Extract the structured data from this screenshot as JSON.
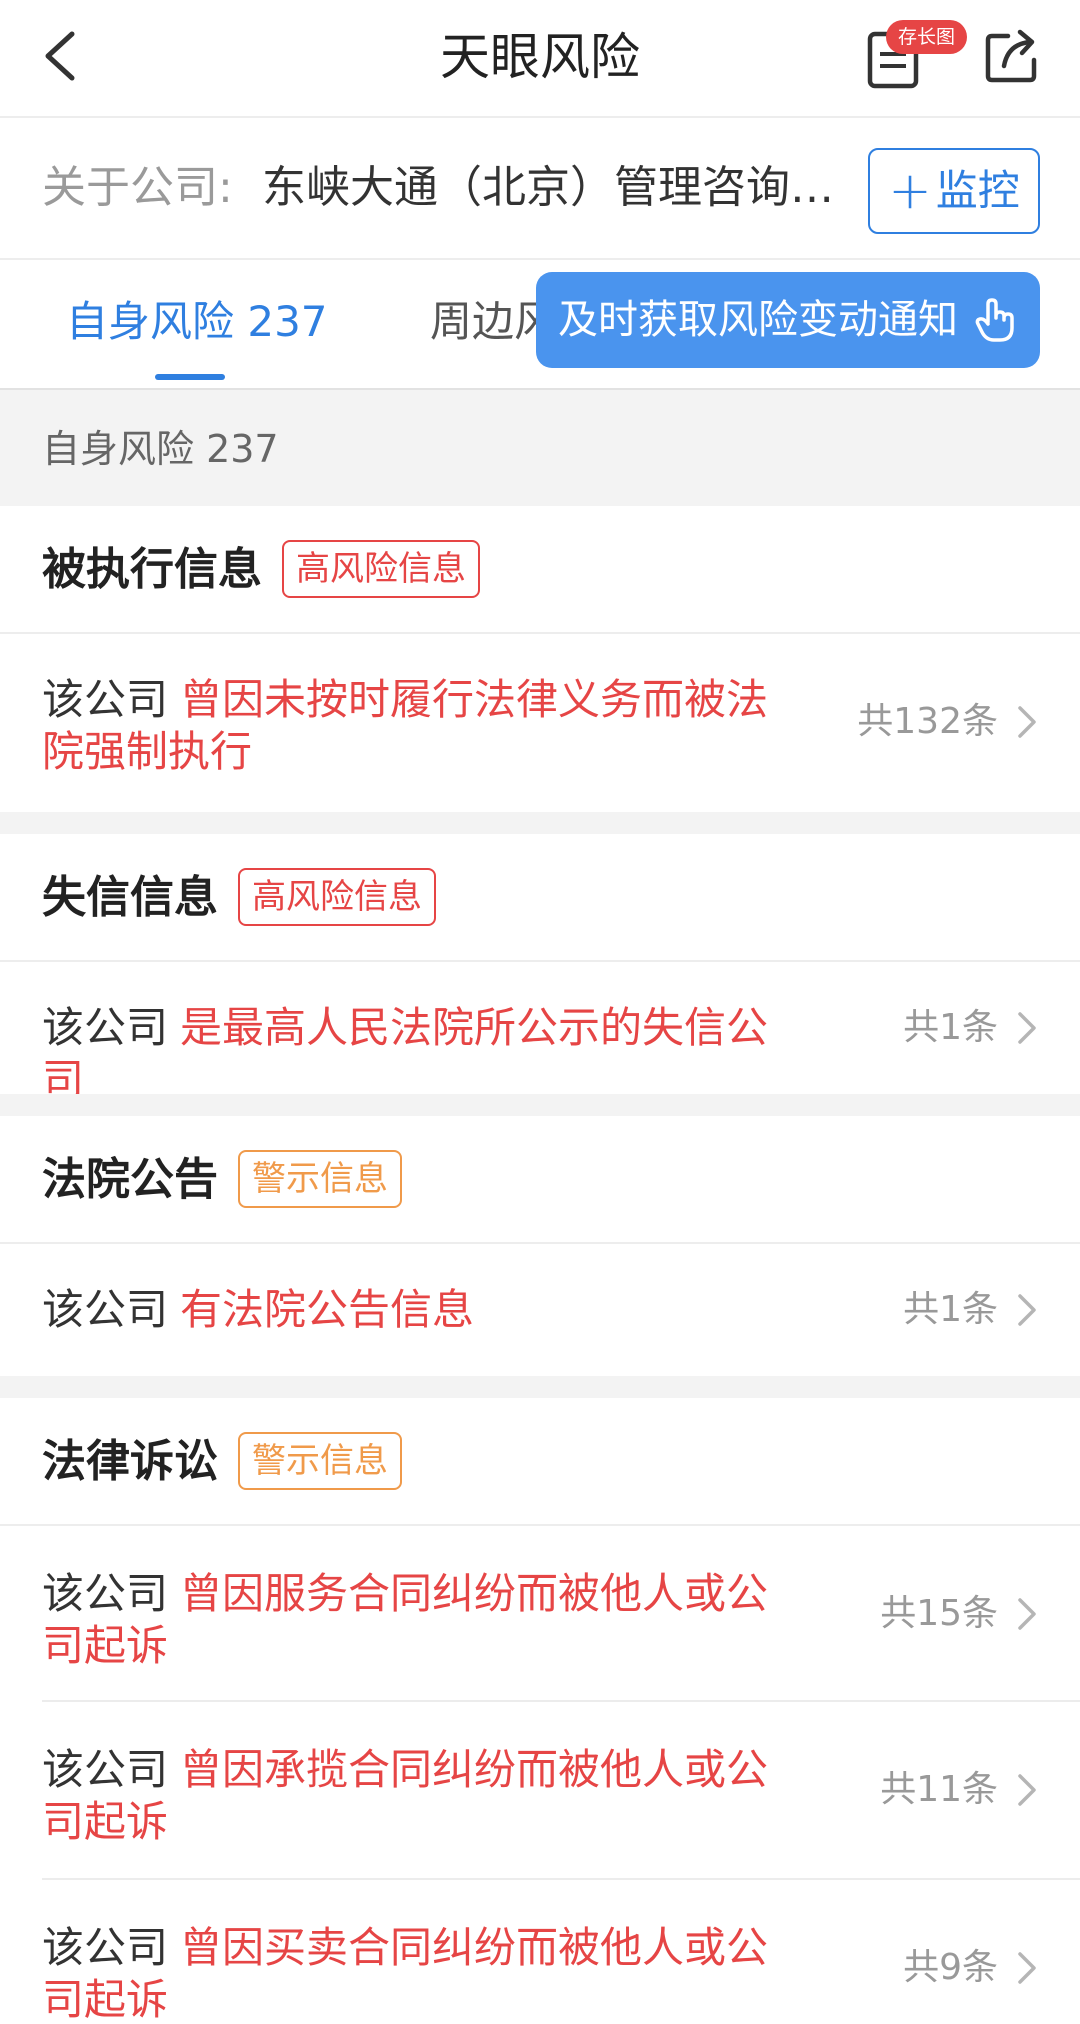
{
  "header": {
    "title": "天眼风险",
    "long_image_badge": "存长图"
  },
  "company": {
    "label": "关于公司:",
    "name": "东峡大通（北京）管理咨询…",
    "monitor_label": "监控"
  },
  "tabs": {
    "self": "自身风险 237",
    "around": "周边风"
  },
  "tooltip": {
    "text": "及时获取风险变动通知"
  },
  "summary": {
    "text": "自身风险 237"
  },
  "sections": [
    {
      "title": "被执行信息",
      "tag": "高风险信息",
      "items": [
        {
          "prefix": "该公司",
          "desc": "曾因未按时履行法律义务而被法院强制执行",
          "count": "共132条"
        }
      ]
    },
    {
      "title": "失信信息",
      "tag": "高风险信息",
      "items": [
        {
          "prefix": "该公司",
          "desc": "是最高人民法院所公示的失信公司",
          "count": "共1条"
        }
      ]
    },
    {
      "title": "法院公告",
      "tag": "警示信息",
      "items": [
        {
          "prefix": "该公司",
          "desc": "有法院公告信息",
          "count": "共1条"
        }
      ]
    },
    {
      "title": "法律诉讼",
      "tag": "警示信息",
      "items": [
        {
          "prefix": "该公司",
          "desc": "曾因服务合同纠纷而被他人或公司起诉",
          "count": "共15条"
        },
        {
          "prefix": "该公司",
          "desc": "曾因承揽合同纠纷而被他人或公司起诉",
          "count": "共11条"
        },
        {
          "prefix": "该公司",
          "desc": "曾因买卖合同纠纷而被他人或公司起诉",
          "count": "共9条"
        }
      ]
    }
  ],
  "colors": {
    "accent": "#2f7fe0",
    "danger": "#e64545",
    "warning": "#f09a4a",
    "tooltip": "#4a94ee"
  }
}
